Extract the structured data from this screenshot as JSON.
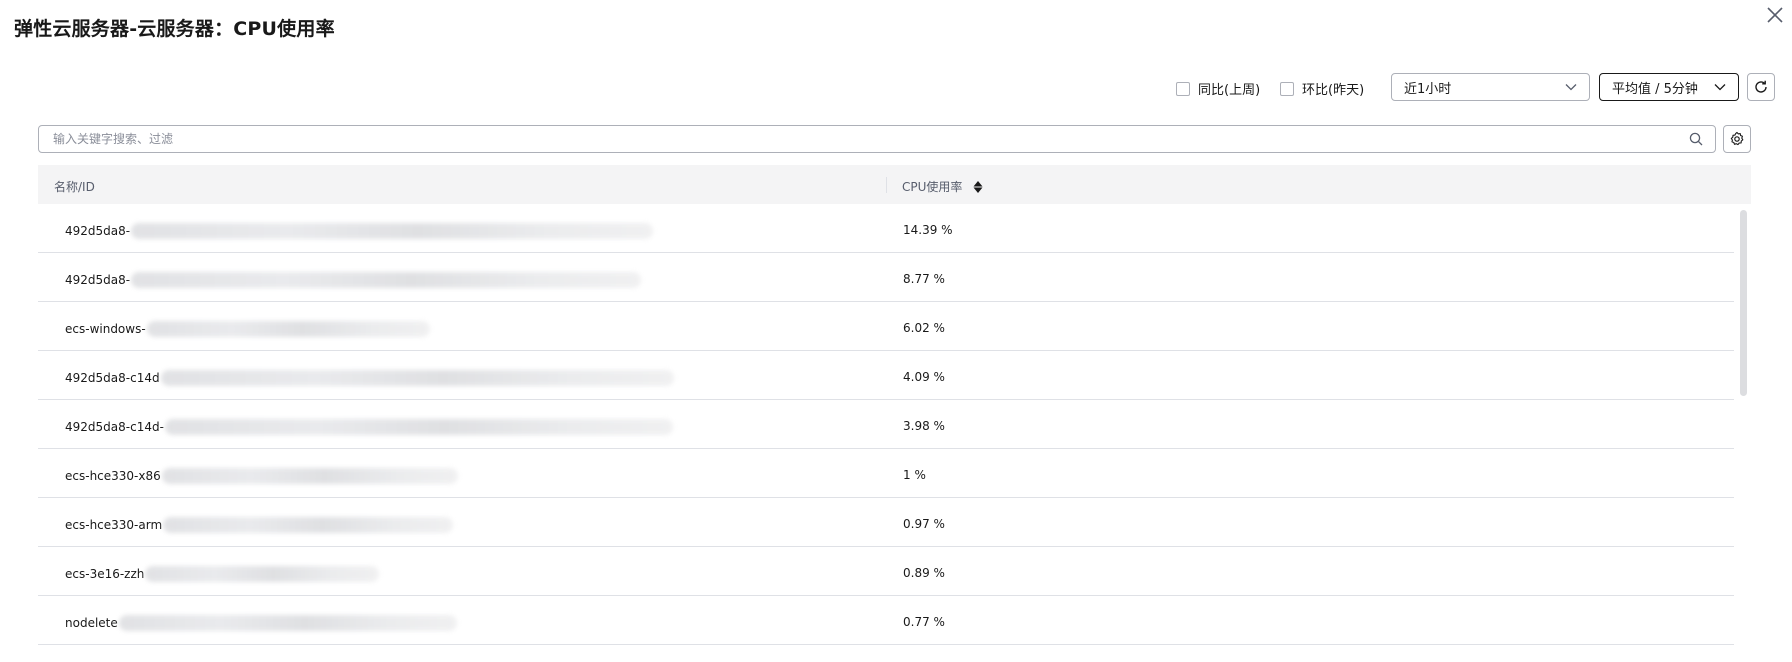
{
  "title": "弹性云服务器-云服务器：CPU使用率",
  "toolbar": {
    "yoy_label": "同比(上周)",
    "mom_label": "环比(昨天)",
    "time_range": "近1小时",
    "aggregation": "平均值 / 5分钟"
  },
  "search": {
    "placeholder": "输入关键字搜索、过滤"
  },
  "table": {
    "columns": {
      "name": "名称/ID",
      "cpu": "CPU使用率"
    },
    "rows": [
      {
        "name": "492d5da8-",
        "value": "14.39 %"
      },
      {
        "name": "492d5da8-",
        "value": "8.77 %"
      },
      {
        "name": "ecs-windows-",
        "value": "6.02 %"
      },
      {
        "name": "492d5da8-c14d",
        "value": "4.09 %"
      },
      {
        "name": "492d5da8-c14d-",
        "value": "3.98 %"
      },
      {
        "name": "ecs-hce330-x86",
        "value": "1 %"
      },
      {
        "name": "ecs-hce330-arm",
        "value": "0.97 %"
      },
      {
        "name": "ecs-3e16-zzh",
        "value": "0.89 %"
      },
      {
        "name": "nodelete",
        "value": "0.77 %"
      }
    ]
  },
  "icons": {
    "close": "close-icon",
    "refresh": "refresh-icon",
    "settings": "gear-icon",
    "search": "search-icon",
    "sort": "sort-icon",
    "dropdown": "chevron-down-icon"
  }
}
